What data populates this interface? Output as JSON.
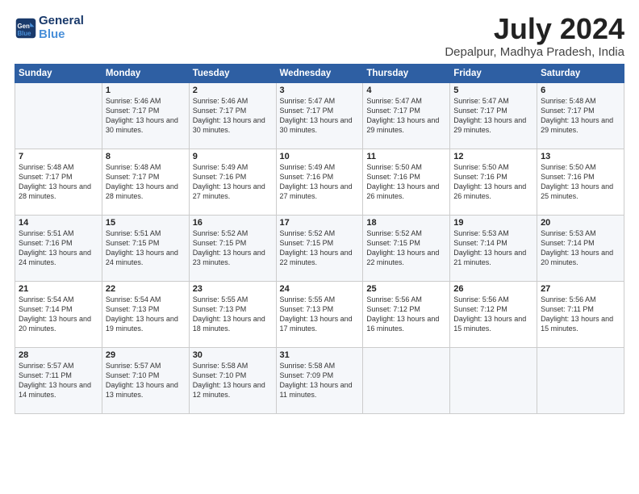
{
  "header": {
    "logo_line1": "General",
    "logo_line2": "Blue",
    "month": "July 2024",
    "location": "Depalpur, Madhya Pradesh, India"
  },
  "weekdays": [
    "Sunday",
    "Monday",
    "Tuesday",
    "Wednesday",
    "Thursday",
    "Friday",
    "Saturday"
  ],
  "weeks": [
    [
      {
        "day": "",
        "sunrise": "",
        "sunset": "",
        "daylight": ""
      },
      {
        "day": "1",
        "sunrise": "Sunrise: 5:46 AM",
        "sunset": "Sunset: 7:17 PM",
        "daylight": "Daylight: 13 hours and 30 minutes."
      },
      {
        "day": "2",
        "sunrise": "Sunrise: 5:46 AM",
        "sunset": "Sunset: 7:17 PM",
        "daylight": "Daylight: 13 hours and 30 minutes."
      },
      {
        "day": "3",
        "sunrise": "Sunrise: 5:47 AM",
        "sunset": "Sunset: 7:17 PM",
        "daylight": "Daylight: 13 hours and 30 minutes."
      },
      {
        "day": "4",
        "sunrise": "Sunrise: 5:47 AM",
        "sunset": "Sunset: 7:17 PM",
        "daylight": "Daylight: 13 hours and 29 minutes."
      },
      {
        "day": "5",
        "sunrise": "Sunrise: 5:47 AM",
        "sunset": "Sunset: 7:17 PM",
        "daylight": "Daylight: 13 hours and 29 minutes."
      },
      {
        "day": "6",
        "sunrise": "Sunrise: 5:48 AM",
        "sunset": "Sunset: 7:17 PM",
        "daylight": "Daylight: 13 hours and 29 minutes."
      }
    ],
    [
      {
        "day": "7",
        "sunrise": "Sunrise: 5:48 AM",
        "sunset": "Sunset: 7:17 PM",
        "daylight": "Daylight: 13 hours and 28 minutes."
      },
      {
        "day": "8",
        "sunrise": "Sunrise: 5:48 AM",
        "sunset": "Sunset: 7:17 PM",
        "daylight": "Daylight: 13 hours and 28 minutes."
      },
      {
        "day": "9",
        "sunrise": "Sunrise: 5:49 AM",
        "sunset": "Sunset: 7:16 PM",
        "daylight": "Daylight: 13 hours and 27 minutes."
      },
      {
        "day": "10",
        "sunrise": "Sunrise: 5:49 AM",
        "sunset": "Sunset: 7:16 PM",
        "daylight": "Daylight: 13 hours and 27 minutes."
      },
      {
        "day": "11",
        "sunrise": "Sunrise: 5:50 AM",
        "sunset": "Sunset: 7:16 PM",
        "daylight": "Daylight: 13 hours and 26 minutes."
      },
      {
        "day": "12",
        "sunrise": "Sunrise: 5:50 AM",
        "sunset": "Sunset: 7:16 PM",
        "daylight": "Daylight: 13 hours and 26 minutes."
      },
      {
        "day": "13",
        "sunrise": "Sunrise: 5:50 AM",
        "sunset": "Sunset: 7:16 PM",
        "daylight": "Daylight: 13 hours and 25 minutes."
      }
    ],
    [
      {
        "day": "14",
        "sunrise": "Sunrise: 5:51 AM",
        "sunset": "Sunset: 7:16 PM",
        "daylight": "Daylight: 13 hours and 24 minutes."
      },
      {
        "day": "15",
        "sunrise": "Sunrise: 5:51 AM",
        "sunset": "Sunset: 7:15 PM",
        "daylight": "Daylight: 13 hours and 24 minutes."
      },
      {
        "day": "16",
        "sunrise": "Sunrise: 5:52 AM",
        "sunset": "Sunset: 7:15 PM",
        "daylight": "Daylight: 13 hours and 23 minutes."
      },
      {
        "day": "17",
        "sunrise": "Sunrise: 5:52 AM",
        "sunset": "Sunset: 7:15 PM",
        "daylight": "Daylight: 13 hours and 22 minutes."
      },
      {
        "day": "18",
        "sunrise": "Sunrise: 5:52 AM",
        "sunset": "Sunset: 7:15 PM",
        "daylight": "Daylight: 13 hours and 22 minutes."
      },
      {
        "day": "19",
        "sunrise": "Sunrise: 5:53 AM",
        "sunset": "Sunset: 7:14 PM",
        "daylight": "Daylight: 13 hours and 21 minutes."
      },
      {
        "day": "20",
        "sunrise": "Sunrise: 5:53 AM",
        "sunset": "Sunset: 7:14 PM",
        "daylight": "Daylight: 13 hours and 20 minutes."
      }
    ],
    [
      {
        "day": "21",
        "sunrise": "Sunrise: 5:54 AM",
        "sunset": "Sunset: 7:14 PM",
        "daylight": "Daylight: 13 hours and 20 minutes."
      },
      {
        "day": "22",
        "sunrise": "Sunrise: 5:54 AM",
        "sunset": "Sunset: 7:13 PM",
        "daylight": "Daylight: 13 hours and 19 minutes."
      },
      {
        "day": "23",
        "sunrise": "Sunrise: 5:55 AM",
        "sunset": "Sunset: 7:13 PM",
        "daylight": "Daylight: 13 hours and 18 minutes."
      },
      {
        "day": "24",
        "sunrise": "Sunrise: 5:55 AM",
        "sunset": "Sunset: 7:13 PM",
        "daylight": "Daylight: 13 hours and 17 minutes."
      },
      {
        "day": "25",
        "sunrise": "Sunrise: 5:56 AM",
        "sunset": "Sunset: 7:12 PM",
        "daylight": "Daylight: 13 hours and 16 minutes."
      },
      {
        "day": "26",
        "sunrise": "Sunrise: 5:56 AM",
        "sunset": "Sunset: 7:12 PM",
        "daylight": "Daylight: 13 hours and 15 minutes."
      },
      {
        "day": "27",
        "sunrise": "Sunrise: 5:56 AM",
        "sunset": "Sunset: 7:11 PM",
        "daylight": "Daylight: 13 hours and 15 minutes."
      }
    ],
    [
      {
        "day": "28",
        "sunrise": "Sunrise: 5:57 AM",
        "sunset": "Sunset: 7:11 PM",
        "daylight": "Daylight: 13 hours and 14 minutes."
      },
      {
        "day": "29",
        "sunrise": "Sunrise: 5:57 AM",
        "sunset": "Sunset: 7:10 PM",
        "daylight": "Daylight: 13 hours and 13 minutes."
      },
      {
        "day": "30",
        "sunrise": "Sunrise: 5:58 AM",
        "sunset": "Sunset: 7:10 PM",
        "daylight": "Daylight: 13 hours and 12 minutes."
      },
      {
        "day": "31",
        "sunrise": "Sunrise: 5:58 AM",
        "sunset": "Sunset: 7:09 PM",
        "daylight": "Daylight: 13 hours and 11 minutes."
      },
      {
        "day": "",
        "sunrise": "",
        "sunset": "",
        "daylight": ""
      },
      {
        "day": "",
        "sunrise": "",
        "sunset": "",
        "daylight": ""
      },
      {
        "day": "",
        "sunrise": "",
        "sunset": "",
        "daylight": ""
      }
    ]
  ]
}
